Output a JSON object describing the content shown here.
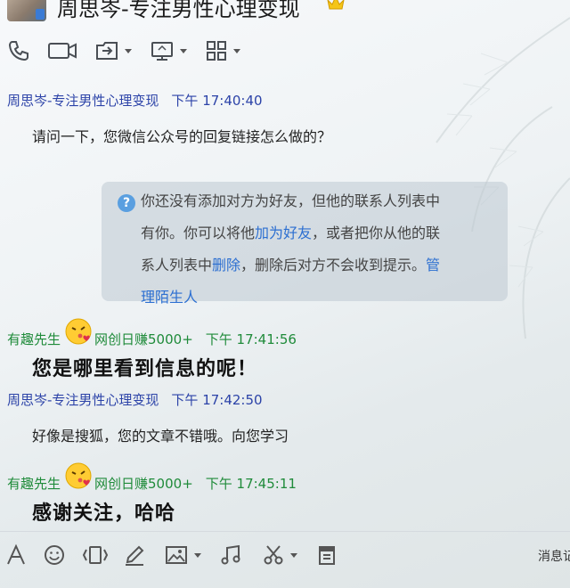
{
  "window": {
    "title": "周思岑-专注男性心理变现"
  },
  "toolbar": {
    "icons": [
      "phone-icon",
      "video-icon",
      "share-screen-icon",
      "remote-desktop-icon",
      "apps-grid-icon"
    ]
  },
  "messages": [
    {
      "sender": "周思岑-专注男性心理变现",
      "sender_color": "#2c43a8",
      "title_tag": "",
      "time": "下午 17:40:40",
      "text": "请问一下，您微信公众号的回复链接怎么做的？",
      "style": "normal"
    },
    {
      "sender": "有趣先生",
      "sender_color": "#1f8b3a",
      "title_tag": "网创日赚5000+",
      "time": "下午 17:41:56",
      "text": "您是哪里看到信息的呢！",
      "style": "big"
    },
    {
      "sender": "周思岑-专注男性心理变现",
      "sender_color": "#2c43a8",
      "title_tag": "",
      "time": "下午 17:42:50",
      "text": "好像是搜狐，您的文章不错哦。向您学习",
      "style": "normal"
    },
    {
      "sender": "有趣先生",
      "sender_color": "#1f8b3a",
      "title_tag": "网创日赚5000+",
      "time": "下午 17:45:11",
      "text": "感谢关注，哈哈",
      "style": "big"
    }
  ],
  "notice": {
    "line1": "你还没有添加对方为好友，但他的联系人列表中",
    "line2_pre": "有你。你可以将他",
    "line2_link": "加为好友",
    "line2_post": "，或者把你从他的联",
    "line3_pre": "系人列表中",
    "line3_link": "删除",
    "line3_mid": "，删除后对方不会收到提示。",
    "line3_link2": "管",
    "line4_link": "理陌生人"
  },
  "bottom_toolbar": {
    "icons": [
      "font-icon",
      "emoji-icon",
      "shake-icon",
      "doodle-icon",
      "image-icon",
      "music-icon",
      "screenshot-icon",
      "history-icon"
    ],
    "message_record_label": "消息记"
  }
}
